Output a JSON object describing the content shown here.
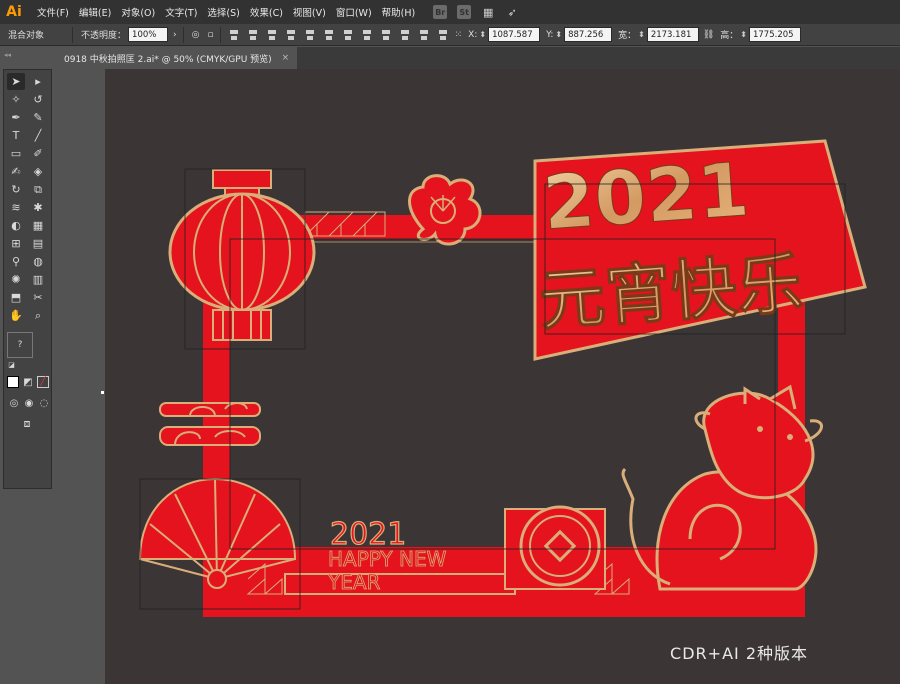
{
  "app": {
    "logo": "Ai"
  },
  "menu": [
    "文件(F)",
    "编辑(E)",
    "对象(O)",
    "文字(T)",
    "选择(S)",
    "效果(C)",
    "视图(V)",
    "窗口(W)",
    "帮助(H)"
  ],
  "topbar_icons": [
    "Br",
    "St",
    "workspace-icon",
    "send-icon"
  ],
  "control": {
    "selection_label": "混合对象",
    "opacity_label": "不透明度：",
    "opacity_value": "100%",
    "x_label": "X:",
    "x_value": "1087.587",
    "y_label": "Y:",
    "y_value": "887.256",
    "w_label": "宽：",
    "w_value": "2173.181",
    "h_label": "高：",
    "h_value": "1775.205"
  },
  "document_tab": {
    "title": "0918 中秋拍照匡 2.ai* @ 50% (CMYK/GPU 预览)",
    "close": "×"
  },
  "artwork": {
    "year": "2021",
    "festival": "元宵快乐",
    "greeting_year": "2021",
    "greeting_line1": "HAPPY NEW",
    "greeting_line2": "YEAR"
  },
  "watermark": "CDR+AI 2种版本",
  "colors": {
    "red": "#e4131d",
    "gold": "#d9ae78",
    "canvas": "#3b3536",
    "ui_dark": "#323232",
    "ui_mid": "#424242"
  }
}
